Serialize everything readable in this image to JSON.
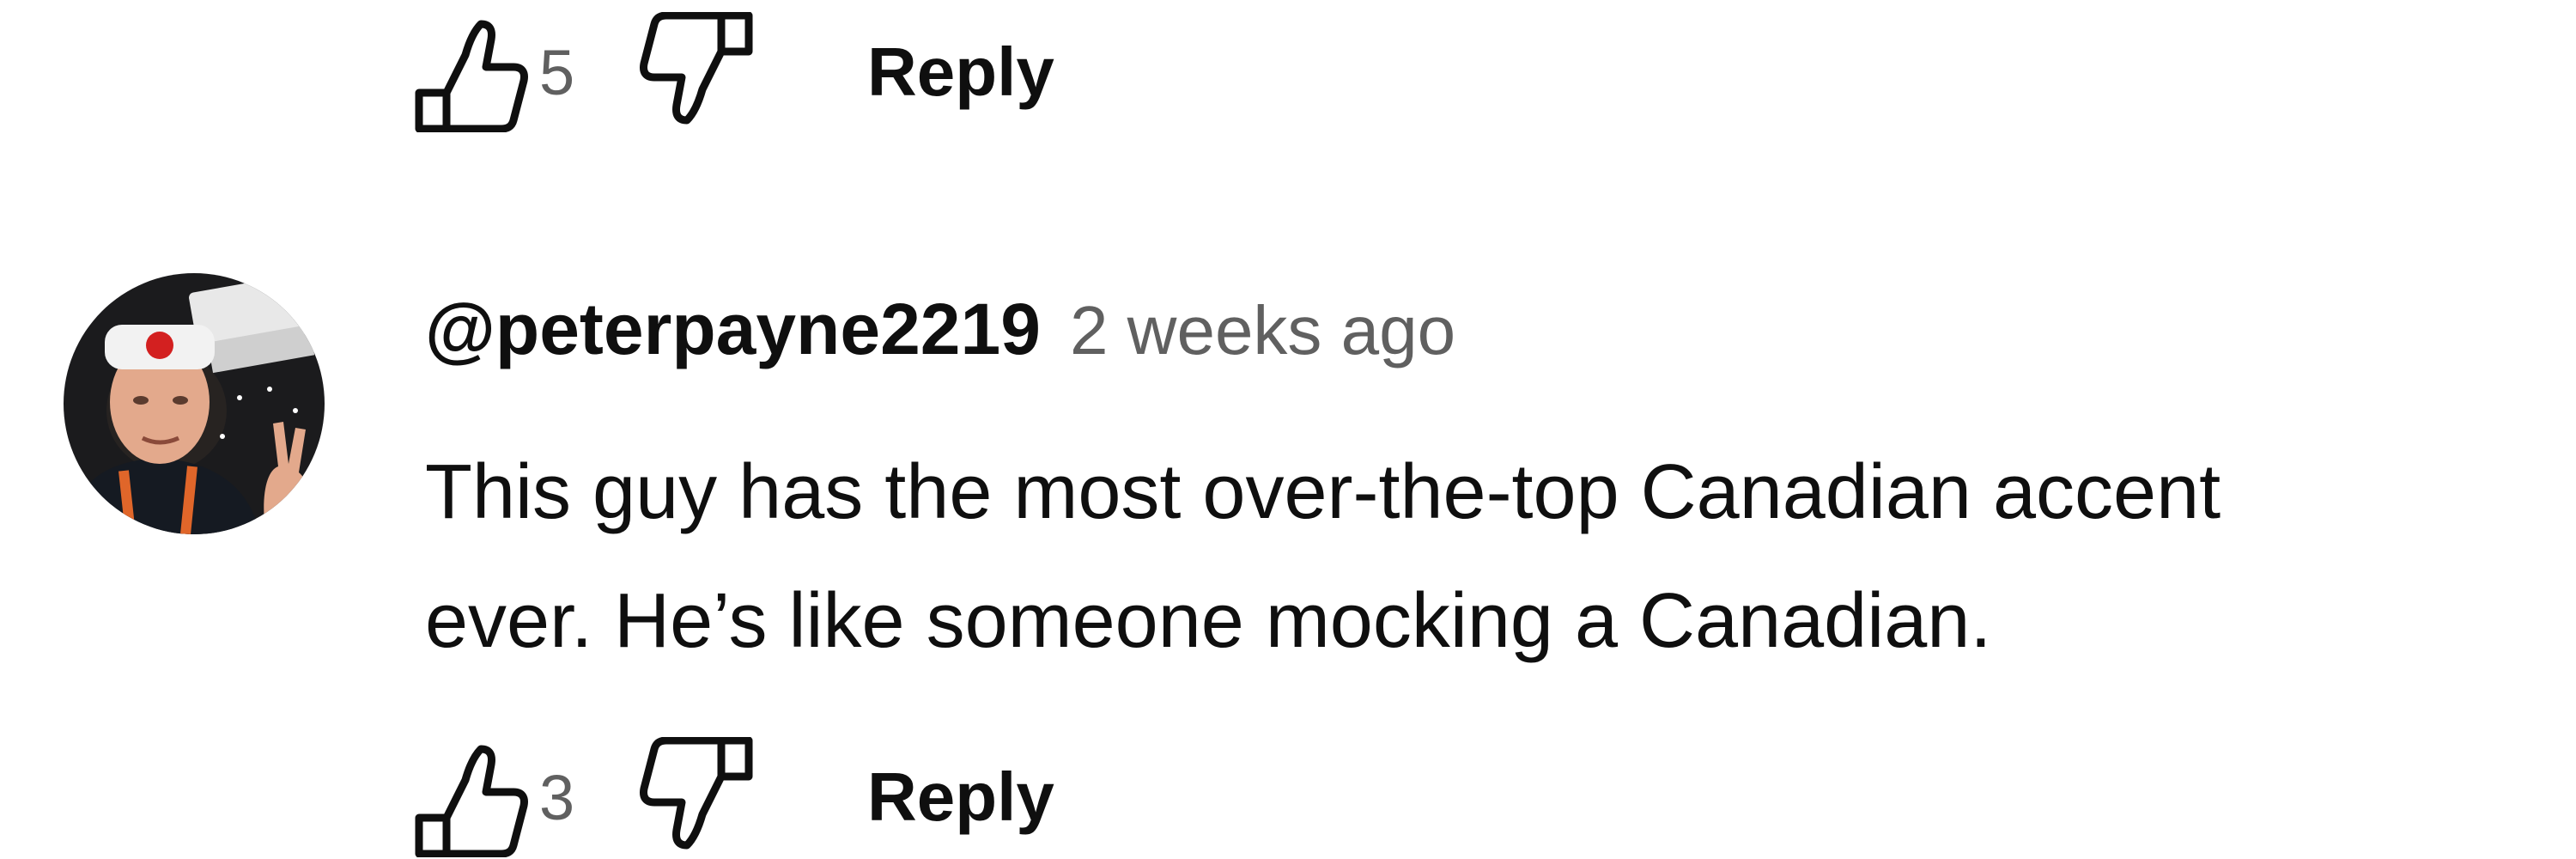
{
  "previous_comment": {
    "like_count": "5",
    "reply_label": "Reply"
  },
  "comment": {
    "author": "@peterpayne2219",
    "timestamp": "2 weeks ago",
    "text_line1": "This guy has the most over-the-top Canadian accent",
    "text_line2": "ever. He’s like someone mocking a Canadian.",
    "like_count": "3",
    "reply_label": "Reply"
  },
  "icons": {
    "like": "thumbs-up-icon",
    "dislike": "thumbs-down-icon"
  },
  "colors": {
    "text_primary": "#0f0f0f",
    "text_secondary": "#606060",
    "background": "#ffffff"
  }
}
